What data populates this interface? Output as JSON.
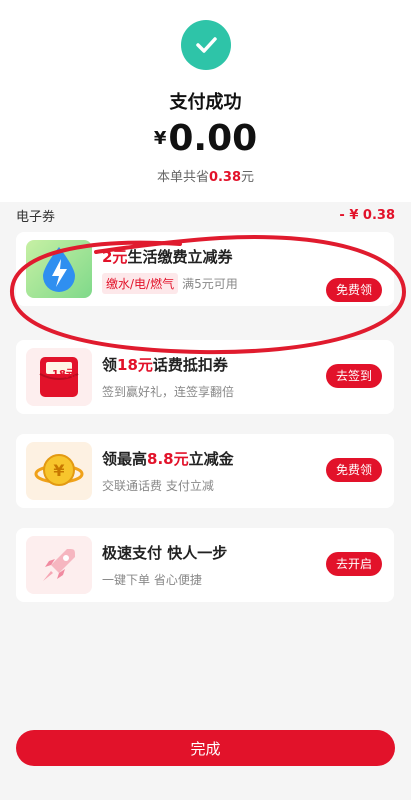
{
  "header": {
    "title": "支付成功",
    "currency": "¥",
    "amount": "0.00",
    "saved_prefix": "本单共省",
    "saved_amount": "0.38",
    "saved_suffix": "元"
  },
  "ecoupon": {
    "label": "电子券",
    "value": "- ¥ 0.38"
  },
  "cards": [
    {
      "title_red": "2元",
      "title_rest": "生活缴费立减券",
      "tag": "缴水/电/燃气",
      "note": "满5元可用",
      "button": "免费领",
      "icon": "water-drop-lightning-icon"
    },
    {
      "title_pre": "领",
      "title_red": "18元",
      "title_rest": "话费抵扣券",
      "sub": "签到赢好礼，连签享翻倍",
      "button": "去签到",
      "badge": "18元",
      "icon": "red-envelope-icon"
    },
    {
      "title_pre": "领最高",
      "title_red": "8.8元",
      "title_rest": "立减金",
      "sub": "交联通话费 支付立减",
      "button": "免费领",
      "icon": "gold-coin-icon"
    },
    {
      "title": "极速支付 快人一步",
      "sub": "一键下单 省心便捷",
      "button": "去开启",
      "icon": "rocket-icon"
    }
  ],
  "footer": {
    "done_label": "完成"
  },
  "colors": {
    "accent": "#e2122a",
    "success": "#2ec4a8"
  }
}
